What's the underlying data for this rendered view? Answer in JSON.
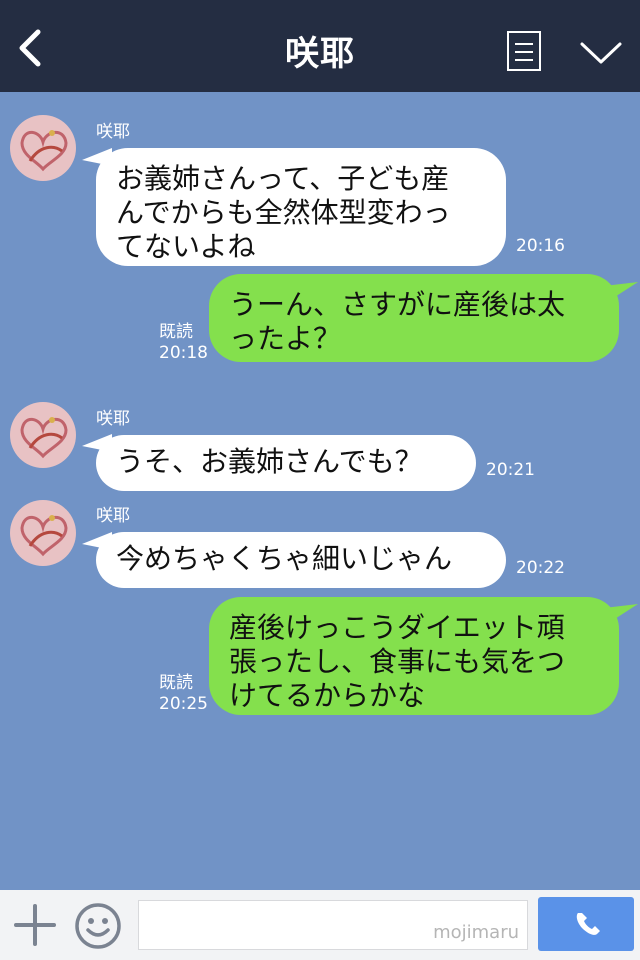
{
  "header": {
    "title": "咲耶",
    "back_icon": "back-chevron-icon",
    "menu_icon": "menu-list-icon",
    "collapse_icon": "chevron-down-icon"
  },
  "messages": [
    {
      "sender": "咲耶",
      "side": "left",
      "text_lines": [
        "お義姉さんって、子ども産",
        "んでからも全然体型変わっ",
        "てないよね"
      ],
      "time": "20:16"
    },
    {
      "sender": "me",
      "side": "right",
      "text_lines": [
        "うーん、さすがに産後は太",
        "ったよ？"
      ],
      "read": "既読",
      "time": "20:18"
    },
    {
      "sender": "咲耶",
      "side": "left",
      "text_lines": [
        "うそ、お義姉さんでも？"
      ],
      "time": "20:21"
    },
    {
      "sender": "咲耶",
      "side": "left",
      "text_lines": [
        "今めちゃくちゃ細いじゃん"
      ],
      "time": "20:22"
    },
    {
      "sender": "me",
      "side": "right",
      "text_lines": [
        "産後けっこうダイエット頑",
        "張ったし、食事にも気をつ",
        "けてるからかな"
      ],
      "read": "既読",
      "time": "20:25"
    }
  ],
  "input": {
    "watermark": "mojimaru"
  },
  "colors": {
    "header_bg": "#242d42",
    "chat_bg": "#7193c6",
    "me_bubble": "#84e04d",
    "other_bubble": "#ffffff",
    "call_btn": "#5a92e8"
  }
}
